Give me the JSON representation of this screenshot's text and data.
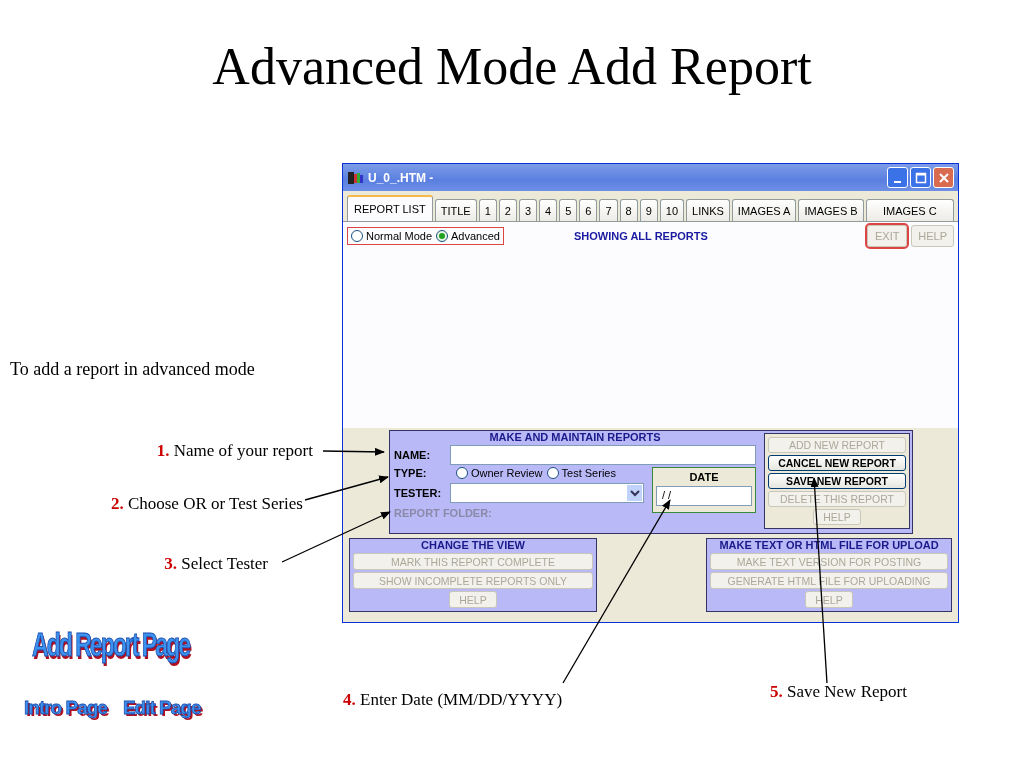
{
  "slide": {
    "title": "Advanced Mode Add Report",
    "intro": "To add a report in advanced mode",
    "steps": [
      {
        "number": "1.",
        "text": "Name of your report"
      },
      {
        "number": "2.",
        "text": "Choose OR or Test Series"
      },
      {
        "number": "3.",
        "text": "Select Tester"
      },
      {
        "number": "4.",
        "text": "Enter Date (MM/DD/YYYY)"
      },
      {
        "number": "5.",
        "text": "Save New Report"
      }
    ],
    "links": {
      "heading": "Add Report Page",
      "items": [
        "Intro Page",
        "Edit Page"
      ]
    }
  },
  "window": {
    "title": "U_0_.HTM -",
    "tabs": [
      {
        "label": "REPORT LIST",
        "selected": true
      },
      {
        "label": "TITLE",
        "selected": false
      },
      {
        "label": "1",
        "selected": false
      },
      {
        "label": "2",
        "selected": false
      },
      {
        "label": "3",
        "selected": false
      },
      {
        "label": "4",
        "selected": false
      },
      {
        "label": "5",
        "selected": false
      },
      {
        "label": "6",
        "selected": false
      },
      {
        "label": "7",
        "selected": false
      },
      {
        "label": "8",
        "selected": false
      },
      {
        "label": "9",
        "selected": false
      },
      {
        "label": "10",
        "selected": false
      },
      {
        "label": "LINKS",
        "selected": false
      },
      {
        "label": "IMAGES A",
        "selected": false
      },
      {
        "label": "IMAGES B",
        "selected": false
      },
      {
        "label": "IMAGES C",
        "selected": false
      }
    ],
    "modes": {
      "highlighted": true,
      "options": [
        {
          "label": "Normal Mode",
          "selected": false
        },
        {
          "label": "Advanced",
          "selected": true
        }
      ]
    },
    "status": "SHOWING ALL REPORTS",
    "top_buttons": [
      {
        "label": "EXIT",
        "disabled": true,
        "highlighted": true
      },
      {
        "label": "HELP",
        "disabled": true,
        "highlighted": false
      }
    ],
    "maintain": {
      "heading": "MAKE AND MAINTAIN REPORTS",
      "name_label": "NAME:",
      "type_label": "TYPE:",
      "types": [
        {
          "label": "Owner Review",
          "selected": false
        },
        {
          "label": "Test Series",
          "selected": false
        }
      ],
      "tester_label": "TESTER:",
      "folder_label": "REPORT FOLDER:",
      "date": {
        "heading": "DATE",
        "value": "/ /"
      },
      "buttons": [
        {
          "label": "ADD NEW REPORT",
          "disabled": true
        },
        {
          "label": "CANCEL NEW REPORT",
          "disabled": false
        },
        {
          "label": "SAVE NEW REPORT",
          "disabled": false
        },
        {
          "label": "DELETE THIS REPORT",
          "disabled": true
        },
        {
          "label": "HELP",
          "disabled": true
        }
      ]
    },
    "panels": [
      {
        "heading": "CHANGE THE VIEW",
        "buttons": [
          {
            "label": "MARK THIS REPORT COMPLETE",
            "disabled": true
          },
          {
            "label": "SHOW INCOMPLETE REPORTS ONLY",
            "disabled": true
          },
          {
            "label": "HELP",
            "disabled": true
          }
        ]
      },
      {
        "heading": "MAKE TEXT OR HTML FILE FOR UPLOAD",
        "buttons": [
          {
            "label": "MAKE TEXT VERSION FOR POSTING",
            "disabled": true
          },
          {
            "label": "GENERATE HTML FILE FOR UPLOADING",
            "disabled": true
          },
          {
            "label": "HELP",
            "disabled": true
          }
        ]
      }
    ]
  }
}
